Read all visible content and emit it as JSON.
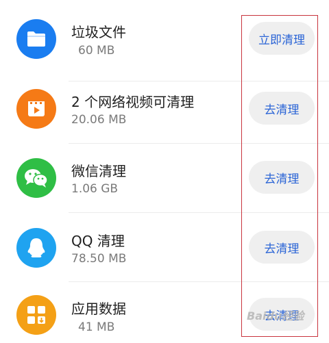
{
  "items": [
    {
      "title": "垃圾文件",
      "size": "60 MB",
      "button": "立即清理",
      "icon": "folder-icon",
      "color": "#1a7df0"
    },
    {
      "title": "2 个网络视频可清理",
      "size": "20.06 MB",
      "button": "去清理",
      "icon": "video-icon",
      "color": "#f57a16"
    },
    {
      "title": "微信清理",
      "size": "1.06 GB",
      "button": "去清理",
      "icon": "wechat-icon",
      "color": "#2fbe45"
    },
    {
      "title": "QQ 清理",
      "size": "78.50 MB",
      "button": "去清理",
      "icon": "qq-icon",
      "color": "#1fa3f0"
    },
    {
      "title": "应用数据",
      "size": "41 MB",
      "button": "去清理",
      "icon": "app-grid-icon",
      "color": "#f4a016"
    }
  ],
  "watermark": "Baidu经验",
  "accent_color": "#2a64d6"
}
